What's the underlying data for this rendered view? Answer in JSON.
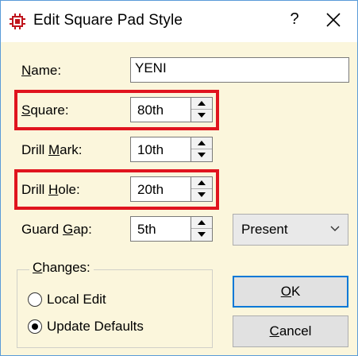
{
  "window": {
    "title": "Edit Square Pad Style",
    "help": "?",
    "close_icon": "close-icon",
    "app_icon": "chip-icon"
  },
  "fields": {
    "name": {
      "label_pre": "",
      "label_u": "N",
      "label_post": "ame:",
      "value": "YENI"
    },
    "square": {
      "label_pre": "",
      "label_u": "S",
      "label_post": "quare:",
      "value": "80th"
    },
    "drill_mark": {
      "label_pre": "Drill ",
      "label_u": "M",
      "label_post": "ark:",
      "value": "10th"
    },
    "drill_hole": {
      "label_pre": "Drill ",
      "label_u": "H",
      "label_post": "ole:",
      "value": "20th"
    },
    "guard_gap": {
      "label_pre": "Guard ",
      "label_u": "G",
      "label_post": "ap:",
      "value": "5th"
    }
  },
  "guard_mode": {
    "selected": "Present"
  },
  "changes": {
    "label_pre": "",
    "label_u": "C",
    "label_post": "hanges:",
    "options": [
      {
        "label": "Local Edit",
        "selected": false
      },
      {
        "label": "Update Defaults",
        "selected": true
      }
    ]
  },
  "buttons": {
    "ok": {
      "u": "O",
      "rest": "K"
    },
    "cancel": {
      "u": "C",
      "rest": "ancel"
    }
  },
  "colors": {
    "highlight": "#e0141e",
    "dialog_bg": "#fbf6dc",
    "accent": "#0078d7"
  }
}
